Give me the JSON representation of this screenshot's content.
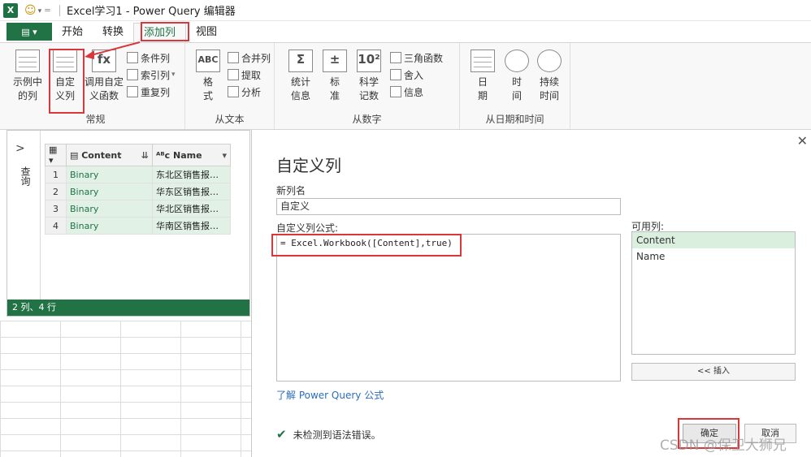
{
  "title_bar": {
    "logo": "X",
    "title": "Excel学习1 - Power Query 编辑器"
  },
  "ribbon_tabs": {
    "file": "▤ ▾",
    "items": [
      "开始",
      "转换",
      "添加列",
      "视图"
    ],
    "active_index": 2
  },
  "ribbon": {
    "general": {
      "label": "常规",
      "example_col": "示例中\n的列",
      "custom_col": "自定\n义列",
      "invoke_fn": "调用自定\n义函数",
      "conditional": "条件列",
      "index": "索引列",
      "duplicate": "重复列"
    },
    "from_text": {
      "label": "从文本",
      "format": "格\n式",
      "merge": "合并列",
      "extract": "提取",
      "parse": "分析"
    },
    "from_number": {
      "label": "从数字",
      "stats": "统计\n信息",
      "standard": "标\n准",
      "scientific": "科学\n记数",
      "trig": "三角函数",
      "round": "舍入",
      "info": "信息"
    },
    "from_datetime": {
      "label": "从日期和时间",
      "date": "日\n期",
      "time": "时\n间",
      "duration": "持续\n时间"
    }
  },
  "query_panel": {
    "side_label": "查询",
    "columns": [
      "Content",
      "Name"
    ],
    "rows": [
      {
        "n": "1",
        "content": "Binary",
        "name": "东北区销售报…"
      },
      {
        "n": "2",
        "content": "Binary",
        "name": "华东区销售报…"
      },
      {
        "n": "3",
        "content": "Binary",
        "name": "华北区销售报…"
      },
      {
        "n": "4",
        "content": "Binary",
        "name": "华南区销售报…"
      }
    ],
    "status": "2 列、4 行"
  },
  "dialog": {
    "title": "自定义列",
    "new_col_label": "新列名",
    "new_col_value": "自定义",
    "formula_label": "自定义列公式:",
    "formula": "= Excel.Workbook([Content],true)",
    "available_label": "可用列:",
    "available_cols": [
      "Content",
      "Name"
    ],
    "insert_btn": "<< 插入",
    "learn_link": "了解 Power Query 公式",
    "syntax_msg": "未检测到语法错误。",
    "ok": "确定",
    "cancel": "取消"
  },
  "watermark": "CSDN @保卫大狮兄"
}
